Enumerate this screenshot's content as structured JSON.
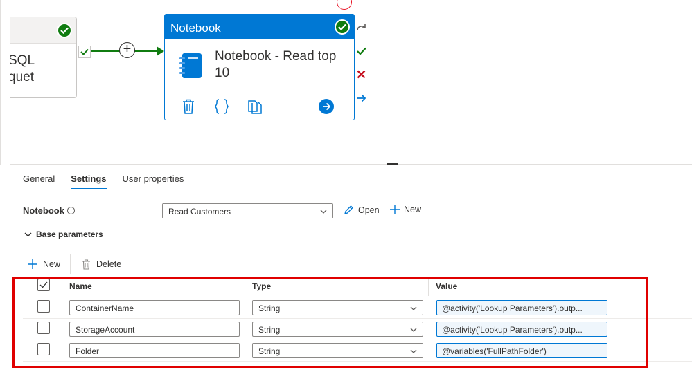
{
  "pipeline": {
    "prev_activity": {
      "line1": "SQL",
      "line2": "quet"
    },
    "notebook_activity": {
      "header": "Notebook",
      "title": "Notebook - Read top 10"
    }
  },
  "tabs": [
    {
      "label": "General",
      "active": false
    },
    {
      "label": "Settings",
      "active": true
    },
    {
      "label": "User properties",
      "active": false
    }
  ],
  "settings": {
    "notebook_label": "Notebook",
    "notebook_value": "Read Customers",
    "open_label": "Open",
    "new_label": "New",
    "base_params_label": "Base parameters"
  },
  "toolbar": {
    "new_label": "New",
    "delete_label": "Delete"
  },
  "grid": {
    "columns": [
      "Name",
      "Type",
      "Value"
    ],
    "rows": [
      {
        "name": "ContainerName",
        "type": "String",
        "value": "@activity('Lookup Parameters').outp..."
      },
      {
        "name": "StorageAccount",
        "type": "String",
        "value": "@activity('Lookup Parameters').outp..."
      },
      {
        "name": "Folder",
        "type": "String",
        "value": "@variables('FullPathFolder')"
      }
    ]
  },
  "colors": {
    "accent": "#0078d4",
    "success": "#107c10",
    "error": "#e00000"
  }
}
